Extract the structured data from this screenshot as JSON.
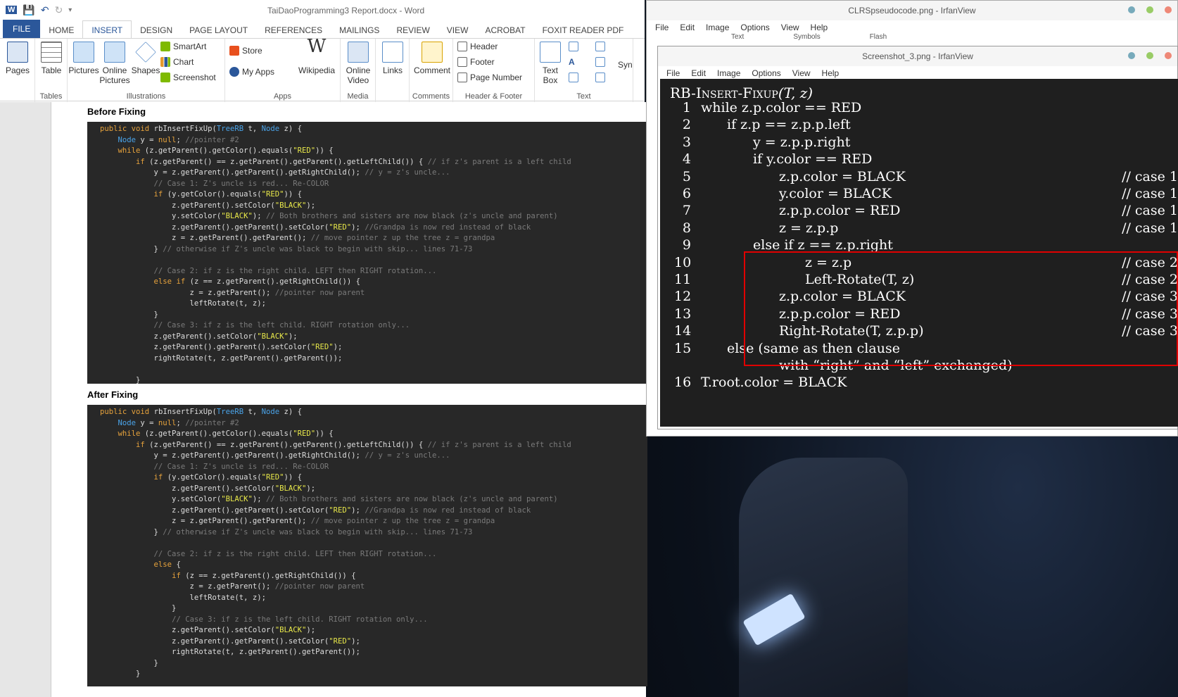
{
  "word": {
    "title": "TaiDaoProgramming3 Report.docx - Word",
    "tabs": [
      "FILE",
      "HOME",
      "INSERT",
      "DESIGN",
      "PAGE LAYOUT",
      "REFERENCES",
      "MAILINGS",
      "REVIEW",
      "VIEW",
      "ACROBAT",
      "FOXIT READER PDF"
    ],
    "ribbon": {
      "pages": "Pages",
      "table": "Table",
      "pictures": "Pictures",
      "online_pictures": "Online Pictures",
      "shapes": "Shapes",
      "smartart": "SmartArt",
      "chart": "Chart",
      "screenshot": "Screenshot",
      "store": "Store",
      "my_apps": "My Apps",
      "wikipedia": "Wikipedia",
      "online_video": "Online Video",
      "links": "Links",
      "comment": "Comment",
      "header": "Header",
      "footer": "Footer",
      "page_number": "Page Number",
      "text_box": "Text Box",
      "sym": "Syn",
      "groups": {
        "tables": "Tables",
        "illustrations": "Illustrations",
        "apps": "Apps",
        "media": "Media",
        "comments": "Comments",
        "header_footer": "Header & Footer",
        "text": "Text"
      }
    },
    "headings": {
      "before": "Before Fixing",
      "after": "After Fixing"
    }
  },
  "before_code": [
    "public void rbInsertFixUp(TreeRB t, Node z) {",
    "    Node y = null; //pointer #2",
    "    while (z.getParent().getColor().equals(\"RED\")) {",
    "        if (z.getParent() == z.getParent().getParent().getLeftChild()) { // if z's parent is a left child",
    "            y = z.getParent().getParent().getRightChild(); // y = z's uncle...",
    "            // Case 1: Z's uncle is red... Re-COLOR",
    "            if (y.getColor().equals(\"RED\")) {",
    "                z.getParent().setColor(\"BLACK\");",
    "                y.setColor(\"BLACK\"); // Both brothers and sisters are now black (z's uncle and parent)",
    "                z.getParent().getParent().setColor(\"RED\"); //Grandpa is now red instead of black",
    "                z = z.getParent().getParent(); // move pointer z up the tree z = grandpa",
    "            } // otherwise if Z's uncle was black to begin with skip... lines 71-73",
    "",
    "            // Case 2: if z is the right child. LEFT then RIGHT rotation...",
    "            else if (z == z.getParent().getRightChild()) {",
    "                    z = z.getParent(); //pointer now parent",
    "                    leftRotate(t, z);",
    "            }",
    "            // Case 3: if z is the left child. RIGHT rotation only...",
    "            z.getParent().setColor(\"BLACK\");",
    "            z.getParent().getParent().setColor(\"RED\");",
    "            rightRotate(t, z.getParent().getParent());",
    "",
    "        }"
  ],
  "after_code": [
    "public void rbInsertFixUp(TreeRB t, Node z) {",
    "    Node y = null; //pointer #2",
    "    while (z.getParent().getColor().equals(\"RED\")) {",
    "        if (z.getParent() == z.getParent().getParent().getLeftChild()) { // if z's parent is a left child",
    "            y = z.getParent().getParent().getRightChild(); // y = z's uncle...",
    "            // Case 1: Z's uncle is red... Re-COLOR",
    "            if (y.getColor().equals(\"RED\")) {",
    "                z.getParent().setColor(\"BLACK\");",
    "                y.setColor(\"BLACK\"); // Both brothers and sisters are now black (z's uncle and parent)",
    "                z.getParent().getParent().setColor(\"RED\"); //Grandpa is now red instead of black",
    "                z = z.getParent().getParent(); // move pointer z up the tree z = grandpa",
    "            } // otherwise if Z's uncle was black to begin with skip... lines 71-73",
    "",
    "            // Case 2: if z is the right child. LEFT then RIGHT rotation...",
    "            else {",
    "                if (z == z.getParent().getRightChild()) {",
    "                    z = z.getParent(); //pointer now parent",
    "                    leftRotate(t, z);",
    "                }",
    "                // Case 3: if z is the left child. RIGHT rotation only...",
    "                z.getParent().setColor(\"BLACK\");",
    "                z.getParent().getParent().setColor(\"RED\");",
    "                rightRotate(t, z.getParent().getParent());",
    "            }",
    "        }"
  ],
  "irfan_back": {
    "title": "CLRSpseudocode.png - IrfanView",
    "menu": [
      "File",
      "Edit",
      "Image",
      "Options",
      "View",
      "Help"
    ],
    "peek": [
      "Text",
      "Symbols",
      "Flash"
    ]
  },
  "irfan_front": {
    "title": "Screenshot_3.png - IrfanView",
    "menu": [
      "File",
      "Edit",
      "Image",
      "Options",
      "View",
      "Help"
    ]
  },
  "pseudocode": {
    "title_prefix": "RB-Insert-Fixup",
    "title_args": "(T, z)",
    "lines": [
      {
        "n": "1",
        "text": "while z.p.color == RED",
        "comment": ""
      },
      {
        "n": "2",
        "text": "if z.p == z.p.p.left",
        "comment": ""
      },
      {
        "n": "3",
        "text": "y = z.p.p.right",
        "comment": ""
      },
      {
        "n": "4",
        "text": "if y.color == RED",
        "comment": ""
      },
      {
        "n": "5",
        "text": "z.p.color = BLACK",
        "comment": "// case 1"
      },
      {
        "n": "6",
        "text": "y.color = BLACK",
        "comment": "// case 1"
      },
      {
        "n": "7",
        "text": "z.p.p.color = RED",
        "comment": "// case 1"
      },
      {
        "n": "8",
        "text": "z = z.p.p",
        "comment": "// case 1"
      },
      {
        "n": "9",
        "text": "else if z == z.p.right",
        "comment": ""
      },
      {
        "n": "10",
        "text": "z = z.p",
        "comment": "// case 2"
      },
      {
        "n": "11",
        "text": "Left-Rotate(T, z)",
        "comment": "// case 2"
      },
      {
        "n": "12",
        "text": "z.p.color = BLACK",
        "comment": "// case 3"
      },
      {
        "n": "13",
        "text": "z.p.p.color = RED",
        "comment": "// case 3"
      },
      {
        "n": "14",
        "text": "Right-Rotate(T, z.p.p)",
        "comment": "// case 3"
      },
      {
        "n": "15",
        "text": "else (same as then clause",
        "comment": ""
      },
      {
        "n": "",
        "text": "with “right” and “left” exchanged)",
        "comment": ""
      },
      {
        "n": "16",
        "text": "T.root.color = BLACK",
        "comment": ""
      }
    ]
  }
}
